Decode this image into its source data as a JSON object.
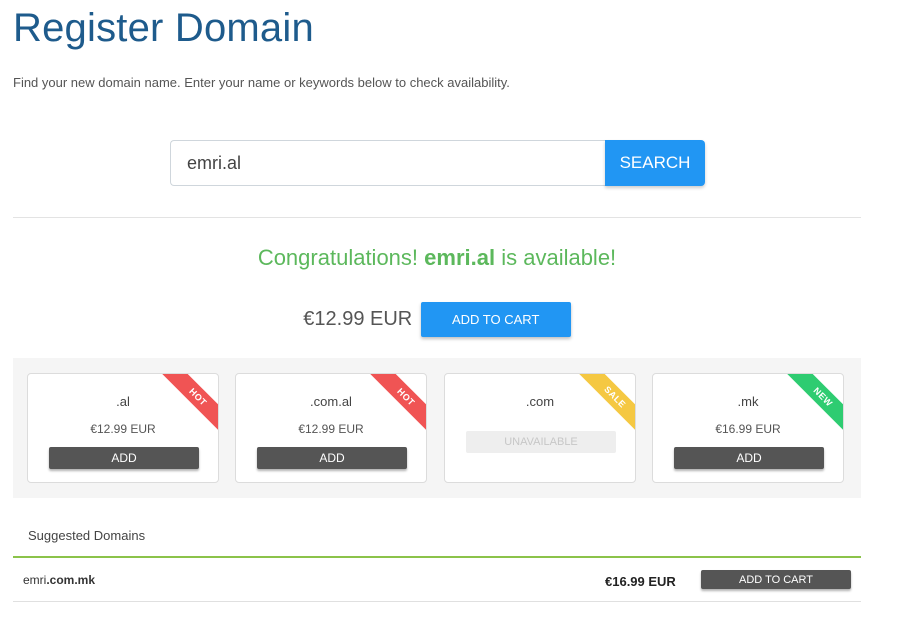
{
  "page": {
    "title": "Register Domain",
    "intro": "Find your new domain name. Enter your name or keywords below to check availability."
  },
  "search": {
    "value": "emri.al",
    "button_label": "SEARCH"
  },
  "result": {
    "prefix": "Congratulations!",
    "domain": "emri.al",
    "suffix": "is available!",
    "price": "€12.99 EUR",
    "add_to_cart_label": "ADD TO CART"
  },
  "tlds": [
    {
      "name": ".al",
      "price": "€12.99 EUR",
      "button_label": "ADD",
      "badge": "HOT",
      "badge_color": "#f05454"
    },
    {
      "name": ".com.al",
      "price": "€12.99 EUR",
      "button_label": "ADD",
      "badge": "HOT",
      "badge_color": "#f05454"
    },
    {
      "name": ".com",
      "status": "UNAVAILABLE",
      "badge": "SALE",
      "badge_color": "#f5c842"
    },
    {
      "name": ".mk",
      "price": "€16.99 EUR",
      "button_label": "ADD",
      "badge": "NEW",
      "badge_color": "#2ecc71"
    }
  ],
  "suggested": {
    "title": "Suggested Domains",
    "items": [
      {
        "domain_prefix": "emri",
        "domain_suffix": ".com.mk",
        "price": "€16.99 EUR",
        "button_label": "ADD TO CART"
      }
    ]
  },
  "colors": {
    "title": "#1e5b8c",
    "accent": "#2196f3",
    "success": "#5cb85c",
    "dark_button": "#555555",
    "suggest_bar": "#8bc34a"
  }
}
